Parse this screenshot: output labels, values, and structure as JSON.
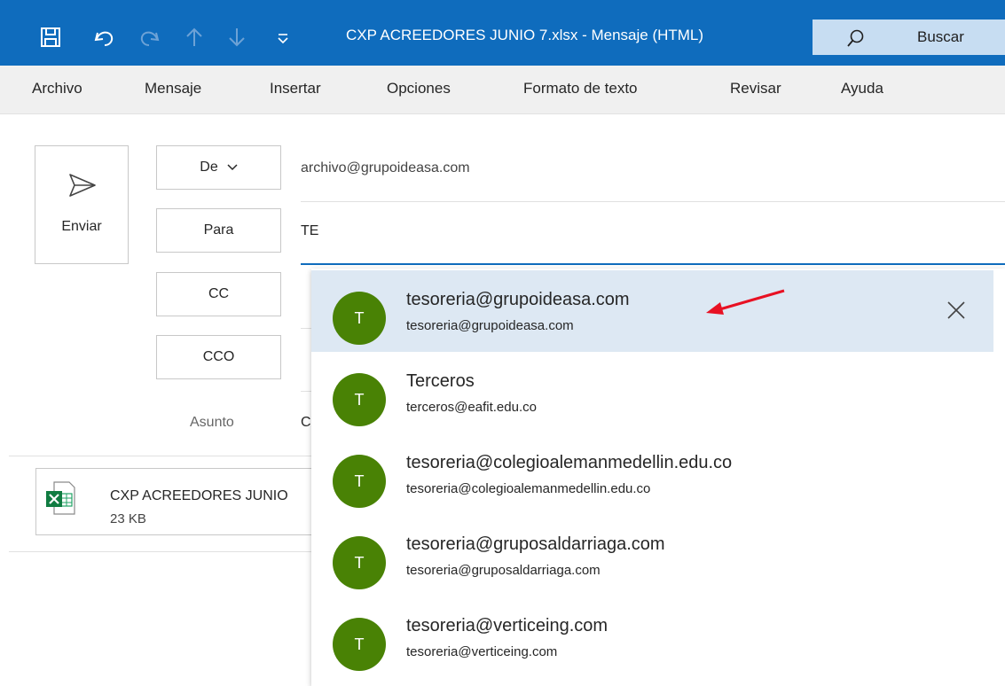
{
  "window": {
    "title": "CXP ACREEDORES JUNIO 7.xlsx  -  Mensaje (HTML)",
    "search_label": "Buscar"
  },
  "menu": [
    "Archivo",
    "Mensaje",
    "Insertar",
    "Opciones",
    "Formato de texto",
    "Revisar",
    "Ayuda"
  ],
  "compose": {
    "send_label": "Enviar",
    "from_label": "De",
    "from_value": "archivo@grupoideasa.com",
    "to_label": "Para",
    "to_value": "TE",
    "cc_label": "CC",
    "bcc_label": "CCO",
    "subject_label": "Asunto",
    "subject_partial": "C"
  },
  "attachment": {
    "name": "CXP ACREEDORES JUNIO",
    "size": "23 KB"
  },
  "suggestions": [
    {
      "initial": "T",
      "name": "tesoreria@grupoideasa.com",
      "email": "tesoreria@grupoideasa.com",
      "selected": true
    },
    {
      "initial": "T",
      "name": "Terceros",
      "email": "terceros@eafit.edu.co",
      "selected": false
    },
    {
      "initial": "T",
      "name": "tesoreria@colegioalemanmedellin.edu.co",
      "email": "tesoreria@colegioalemanmedellin.edu.co",
      "selected": false
    },
    {
      "initial": "T",
      "name": "tesoreria@gruposaldarriaga.com",
      "email": "tesoreria@gruposaldarriaga.com",
      "selected": false
    },
    {
      "initial": "T",
      "name": "tesoreria@verticeing.com",
      "email": "tesoreria@verticeing.com",
      "selected": false
    }
  ],
  "icons": {
    "save": "save-icon",
    "undo": "undo-icon",
    "redo": "redo-icon",
    "up": "arrow-up-icon",
    "down": "arrow-down-icon",
    "customize": "customize-qat-icon",
    "search": "search-icon",
    "send": "send-icon",
    "chevron": "chevron-down-icon",
    "excel": "excel-icon",
    "remove": "close-icon"
  },
  "colors": {
    "title_bar": "#0f6cbd",
    "avatar": "#498205",
    "selection": "#dde8f3",
    "annotation_arrow": "#e81123"
  }
}
